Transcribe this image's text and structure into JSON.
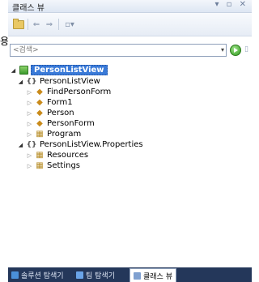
{
  "side_glyph": "용",
  "window": {
    "title": "클래스 뷰",
    "controls": "▾ ▫ ✕"
  },
  "toolbar": {
    "back_arrow": "⇐",
    "forward_arrow": "⇒",
    "settings_glyph": "▫▾"
  },
  "search": {
    "placeholder": "<검색>",
    "value": "",
    "dropdown_arrow": "▾"
  },
  "tree": {
    "root": "PersonListView",
    "namespace_1": "PersonListView",
    "ns_1_items": [
      {
        "label": "FindPersonForm",
        "icon": "class-icon"
      },
      {
        "label": "Form1",
        "icon": "class-icon"
      },
      {
        "label": "Person",
        "icon": "class-icon"
      },
      {
        "label": "PersonForm",
        "icon": "class-icon"
      },
      {
        "label": "Program",
        "icon": "static-class-icon"
      }
    ],
    "namespace_2": "PersonListView.Properties",
    "ns_2_items": [
      {
        "label": "Resources",
        "icon": "static-class-icon"
      },
      {
        "label": "Settings",
        "icon": "static-class-icon"
      }
    ],
    "ns_glyph": "{}",
    "expand_open": "◢",
    "expand_closed": "▷"
  },
  "tabs": [
    {
      "label": "솔루션 탐색기",
      "active": false,
      "color": "#4a8fd8"
    },
    {
      "label": "팀 탐색기",
      "active": false,
      "color": "#6aa4e8"
    },
    {
      "label": "클래스 뷰",
      "active": true,
      "color": "#7fa0d0"
    }
  ]
}
